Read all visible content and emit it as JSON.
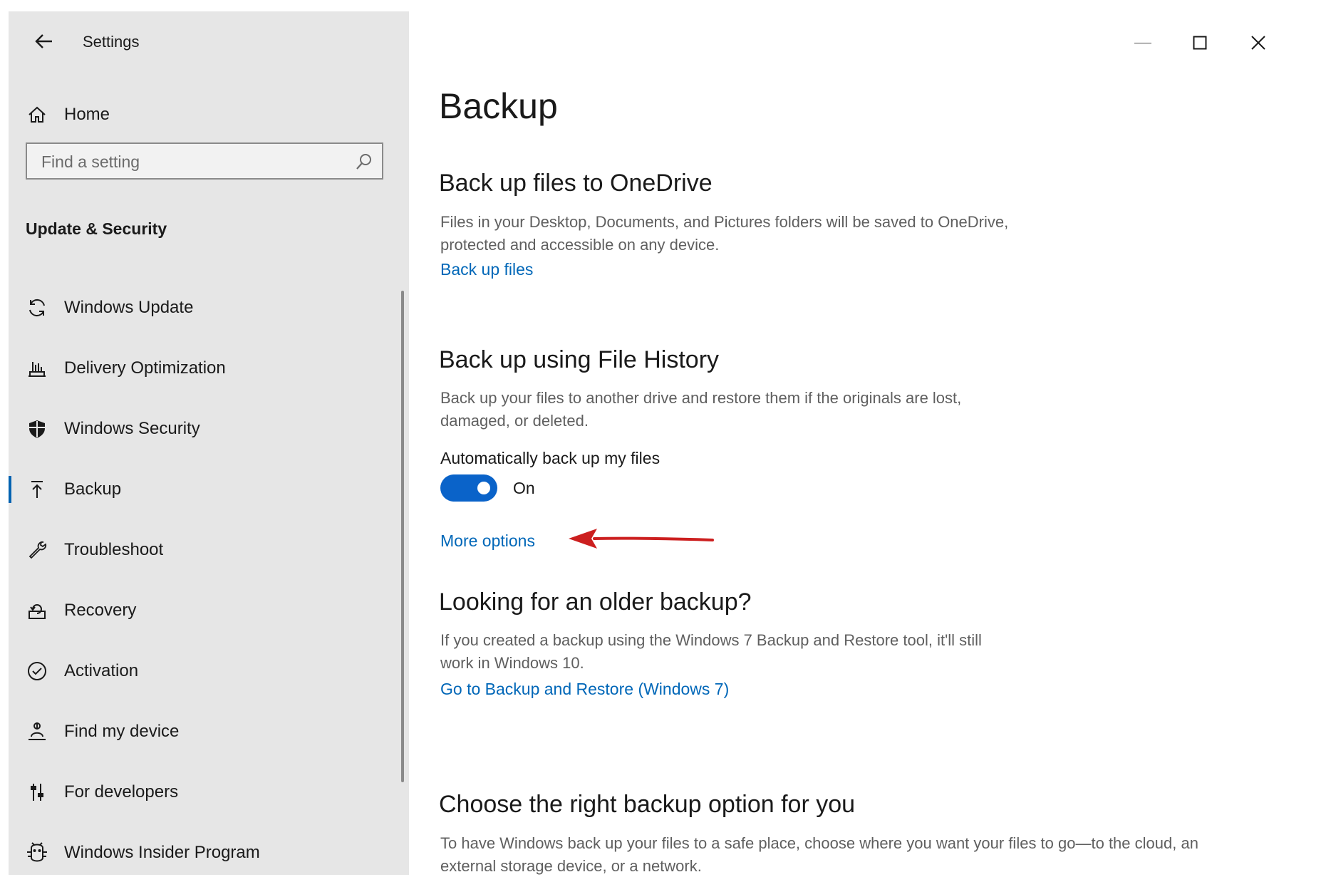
{
  "window": {
    "title": "Settings",
    "minimize_glyph": "—",
    "accent_color": "#0063b1"
  },
  "sidebar": {
    "home_label": "Home",
    "search_placeholder": "Find a setting",
    "section_header": "Update & Security",
    "items": [
      {
        "label": "Windows Update",
        "icon": "sync-icon",
        "active": false
      },
      {
        "label": "Delivery Optimization",
        "icon": "delivery-optimization-icon",
        "active": false
      },
      {
        "label": "Windows Security",
        "icon": "shield-icon",
        "active": false
      },
      {
        "label": "Backup",
        "icon": "backup-arrow-up-icon",
        "active": true
      },
      {
        "label": "Troubleshoot",
        "icon": "wrench-icon",
        "active": false
      },
      {
        "label": "Recovery",
        "icon": "recovery-icon",
        "active": false
      },
      {
        "label": "Activation",
        "icon": "check-circle-icon",
        "active": false
      },
      {
        "label": "Find my device",
        "icon": "person-location-icon",
        "active": false
      },
      {
        "label": "For developers",
        "icon": "developer-sliders-icon",
        "active": false
      },
      {
        "label": "Windows Insider Program",
        "icon": "insider-icon",
        "active": false
      }
    ]
  },
  "main": {
    "page_title": "Backup",
    "onedrive": {
      "heading": "Back up files to OneDrive",
      "description": "Files in your Desktop, Documents, and Pictures folders will be saved to OneDrive, protected and accessible on any device.",
      "link": "Back up files"
    },
    "file_history": {
      "heading": "Back up using File History",
      "description": "Back up your files to another drive and restore them if the originals are lost, damaged, or deleted.",
      "toggle_label": "Automatically back up my files",
      "toggle_state": "On",
      "toggle_on": true,
      "link": "More options"
    },
    "older_backup": {
      "heading": "Looking for an older backup?",
      "description": "If you created a backup using the Windows 7 Backup and Restore tool, it'll still work in Windows 10.",
      "link": "Go to Backup and Restore (Windows 7)"
    },
    "choose": {
      "heading": "Choose the right backup option for you",
      "description": "To have Windows back up your files to a safe place, choose where you want your files to go—to the cloud, an external storage device, or a network."
    }
  },
  "colors": {
    "link": "#0067b8",
    "toggle_on": "#0a63c9",
    "annotation_arrow": "#cc1f1f",
    "sidebar_bg": "#e6e6e6"
  }
}
